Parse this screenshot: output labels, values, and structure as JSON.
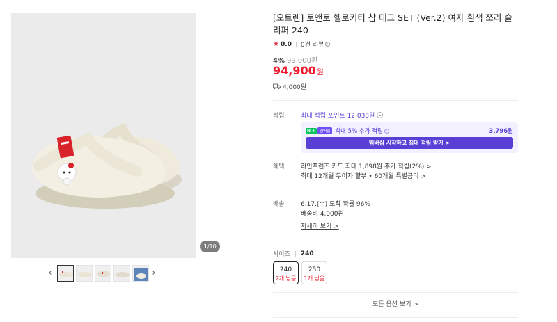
{
  "gallery": {
    "counter_current": "1",
    "counter_total": "/10",
    "prev_arrow": "‹",
    "next_arrow": "›"
  },
  "product": {
    "title": "[오트렌] 토앤토 헬로키티 참 태그 SET (Ver.2) 여자 흰색 쪼리 슬리퍼 240",
    "rating_star": "★",
    "rating_score": "0.0",
    "review_count": "0건 리뷰",
    "discount_pct": "4%",
    "original_price": "99,000원",
    "sale_price": "94,900",
    "sale_price_unit": "원",
    "shipping_fee": "4,000원"
  },
  "points": {
    "label": "적립",
    "max_points": "최대 적립 포인트 12,038원",
    "np_badge": "N +",
    "member_badge": "멤버십",
    "member_extra": "최대 5% 추가 적립",
    "member_amount": "3,796원",
    "member_button": "멤버십 시작하고 최대 적립 받기 >"
  },
  "benefits": {
    "label": "혜택",
    "line1": "라인프렌즈 카드 최대 1,898원 추가 적립(2%) >",
    "line2": "최대 12개월 무이자 할부 • 60개월 특별금리 >"
  },
  "delivery": {
    "label": "배송",
    "line1": "6.17.(수) 도착 확률 96%",
    "line2": "배송비 4,000원",
    "details_link": "자세히 보기 >"
  },
  "sizes": {
    "label": "사이즈",
    "selected": "240",
    "options": [
      {
        "size": "240",
        "stock": "2개 남음"
      },
      {
        "size": "250",
        "stock": "1개 남음"
      }
    ],
    "all_options": "모든 옵션 보기 >"
  },
  "colors": {
    "price_red": "#ec1c2e",
    "membership_purple": "#5a3fd7",
    "naverpay_green": "#03c75a"
  }
}
